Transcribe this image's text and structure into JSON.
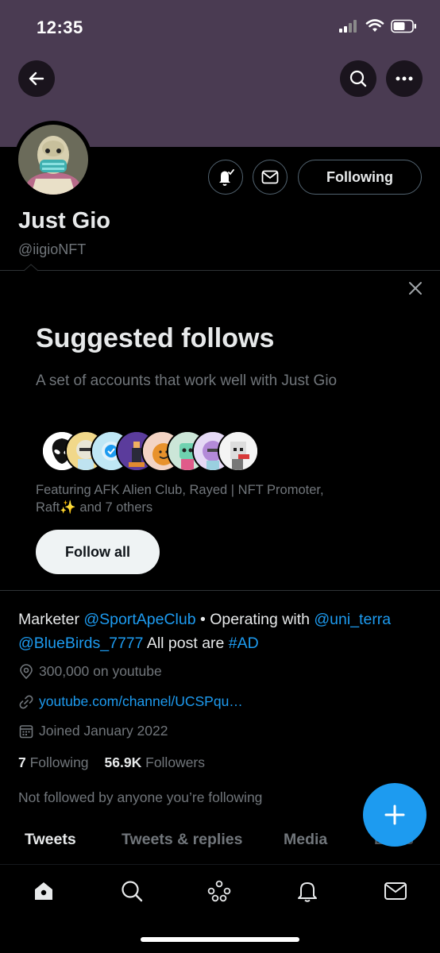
{
  "status_bar": {
    "time": "12:35"
  },
  "profile": {
    "name": "Just Gio",
    "handle": "@iigioNFT",
    "following_label": "Following"
  },
  "suggested": {
    "title": "Suggested follows",
    "subtitle": "A set of accounts that work well with Just Gio",
    "featuring_line1": "Featuring AFK Alien Club, Rayed | NFT Promoter,",
    "featuring_line2_name": "Raft",
    "featuring_line2_emoji": "✨",
    "featuring_line2_rest": " and 7 others",
    "follow_all_label": "Follow all"
  },
  "bio": {
    "p1": "Marketer ",
    "m1": "@SportApeClub",
    "p2": " • Operating with ",
    "m2": "@uni_terra",
    "m3": "@BlueBirds_7777",
    "p3": " All post are ",
    "m4": "#AD"
  },
  "meta": {
    "location": "300,000 on youtube",
    "website": "youtube.com/channel/UCSPqu…",
    "joined": "Joined January 2022"
  },
  "counts": {
    "following_value": "7",
    "following_label": "Following",
    "followers_value": "56.9K",
    "followers_label": "Followers"
  },
  "not_followed": "Not followed by anyone you’re following",
  "tabs": [
    "Tweets",
    "Tweets & replies",
    "Media",
    "Likes"
  ],
  "colors": {
    "accent": "#1d9bf0",
    "banner": "#4a3b52",
    "background": "#000000"
  },
  "icons": [
    "back-arrow-icon",
    "search-icon",
    "more-icon",
    "bell-check-icon",
    "mail-icon",
    "close-icon",
    "location-icon",
    "link-icon",
    "calendar-icon",
    "plus-icon",
    "home-icon",
    "spaces-icon",
    "notifications-icon"
  ]
}
